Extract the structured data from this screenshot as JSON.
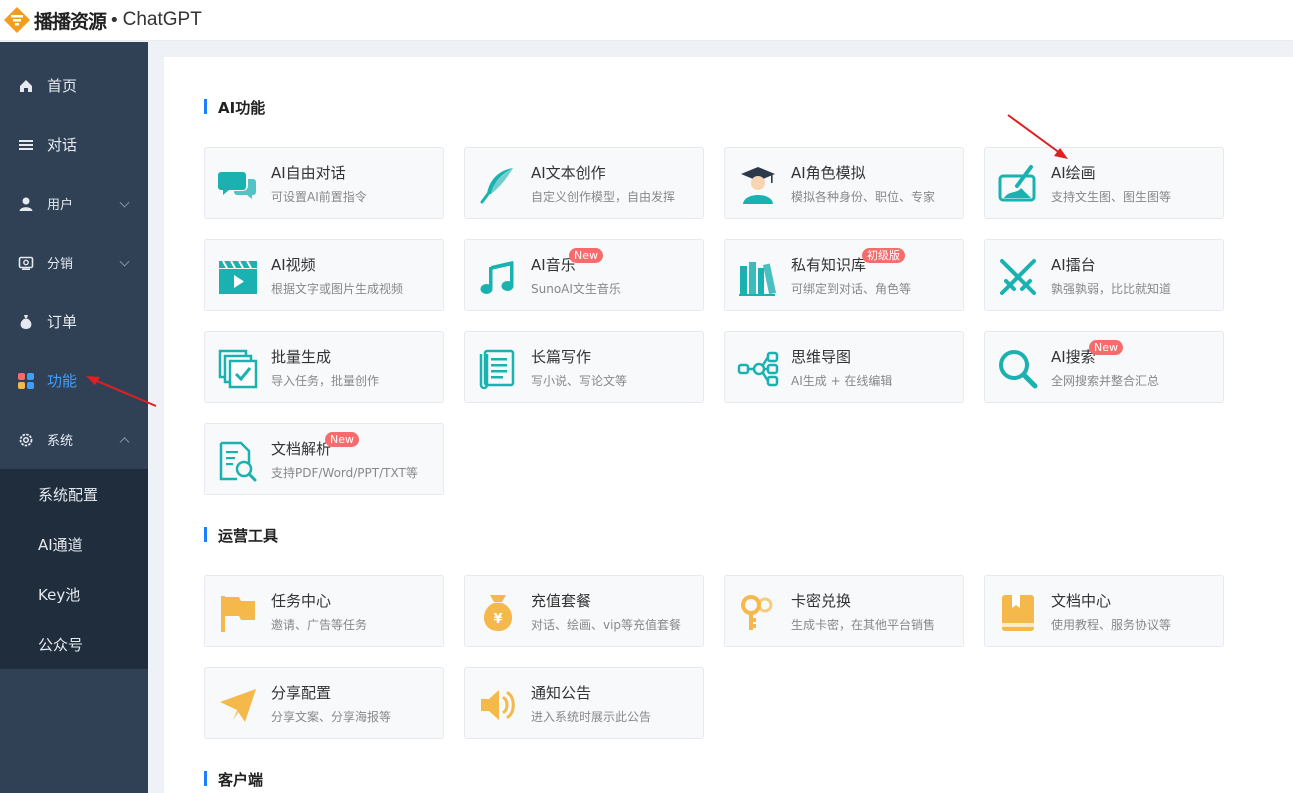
{
  "header": {
    "brand": "播播资源",
    "dot": "•",
    "app_name": "ChatGPT"
  },
  "sidebar": {
    "items": [
      {
        "label": "首页",
        "icon": "home-icon"
      },
      {
        "label": "对话",
        "icon": "list-icon"
      },
      {
        "label": "用户",
        "icon": "user-icon"
      },
      {
        "label": "分销",
        "icon": "distribution-icon"
      },
      {
        "label": "订单",
        "icon": "money-bag-icon"
      },
      {
        "label": "功能",
        "icon": "apps-icon"
      },
      {
        "label": "系统",
        "icon": "gear-icon"
      }
    ],
    "submenu": [
      "系统配置",
      "AI通道",
      "Key池",
      "公众号"
    ]
  },
  "sections": {
    "ai": {
      "title": "AI功能",
      "cards": [
        {
          "title": "AI自由对话",
          "desc": "可设置AI前置指令",
          "icon": "chat-bubbles-icon"
        },
        {
          "title": "AI文本创作",
          "desc": "自定义创作模型，自由发挥",
          "icon": "feather-quill-icon"
        },
        {
          "title": "AI角色模拟",
          "desc": "模拟各种身份、职位、专家",
          "icon": "graduate-avatar-icon"
        },
        {
          "title": "AI绘画",
          "desc": "支持文生图、图生图等",
          "icon": "paint-brush-icon"
        },
        {
          "title": "AI视频",
          "desc": "根据文字或图片生成视频",
          "icon": "clapper-video-icon"
        },
        {
          "title": "AI音乐",
          "desc": "SunoAI文生音乐",
          "icon": "music-note-icon",
          "badge": "New"
        },
        {
          "title": "私有知识库",
          "desc": "可绑定到对话、角色等",
          "icon": "books-icon",
          "badge": "初级版"
        },
        {
          "title": "AI擂台",
          "desc": "孰强孰弱，比比就知道",
          "icon": "crossed-swords-icon"
        },
        {
          "title": "批量生成",
          "desc": "导入任务，批量创作",
          "icon": "batch-check-icon"
        },
        {
          "title": "长篇写作",
          "desc": "写小说、写论文等",
          "icon": "scroll-document-icon"
        },
        {
          "title": "思维导图",
          "desc": "AI生成 + 在线编辑",
          "icon": "mind-map-icon"
        },
        {
          "title": "AI搜索",
          "desc": "全网搜索并整合汇总",
          "icon": "magnifier-icon",
          "badge": "New"
        },
        {
          "title": "文档解析",
          "desc": "支持PDF/Word/PPT/TXT等",
          "icon": "document-search-icon",
          "badge": "New"
        }
      ]
    },
    "ops": {
      "title": "运营工具",
      "cards": [
        {
          "title": "任务中心",
          "desc": "邀请、广告等任务",
          "icon": "flag-icon"
        },
        {
          "title": "充值套餐",
          "desc": "对话、绘画、vip等充值套餐",
          "icon": "money-bag-icon"
        },
        {
          "title": "卡密兑换",
          "desc": "生成卡密，在其他平台销售",
          "icon": "keys-icon"
        },
        {
          "title": "文档中心",
          "desc": "使用教程、服务协议等",
          "icon": "book-icon"
        },
        {
          "title": "分享配置",
          "desc": "分享文案、分享海报等",
          "icon": "paper-plane-icon"
        },
        {
          "title": "通知公告",
          "desc": "进入系统时展示此公告",
          "icon": "speaker-icon"
        }
      ]
    },
    "client": {
      "title": "客户端"
    }
  },
  "colors": {
    "sidebar_bg": "#304156",
    "submenu_bg": "#1f2d3d",
    "active": "#409eff",
    "teal": "#1ab2b0",
    "amber": "#f4b94a",
    "badge": "#f56c6c",
    "accent_bar": "#1e80ff",
    "arrow": "#e02020"
  }
}
